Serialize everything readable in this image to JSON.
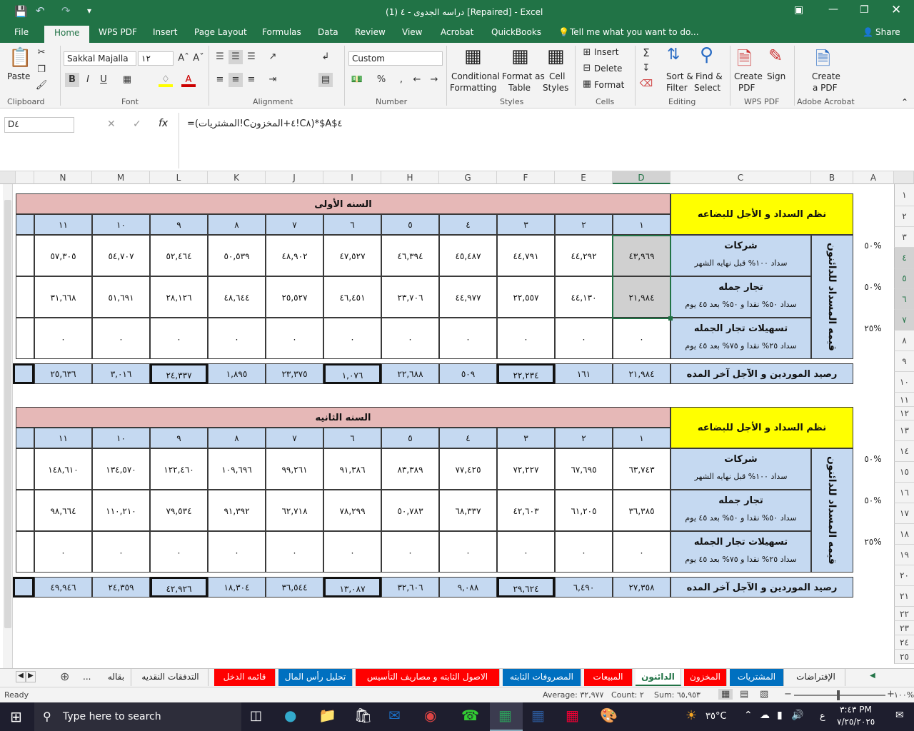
{
  "window": {
    "title": "دراسه الجدوى - ٤ (1) [Repaired] - Excel"
  },
  "tabs": [
    {
      "label": "File"
    },
    {
      "label": "Home"
    },
    {
      "label": "WPS PDF"
    },
    {
      "label": "Insert"
    },
    {
      "label": "Page Layout"
    },
    {
      "label": "Formulas"
    },
    {
      "label": "Data"
    },
    {
      "label": "Review"
    },
    {
      "label": "View"
    },
    {
      "label": "Acrobat"
    },
    {
      "label": "QuickBooks"
    }
  ],
  "tell_me": "Tell me what you want to do...",
  "share": "Share",
  "ribbon": {
    "clipboard": {
      "paste": "Paste",
      "label": "Clipboard"
    },
    "font": {
      "name": "Sakkal Majalla",
      "size": "١٢",
      "label": "Font"
    },
    "alignment": {
      "label": "Alignment"
    },
    "number": {
      "format": "Custom",
      "label": "Number",
      "percent": "%",
      "comma": ","
    },
    "styles": {
      "conditional": "Conditional",
      "formatting": "Formatting",
      "format_as": "Format as",
      "table": "Table",
      "cell": "Cell",
      "cell_styles": "Styles",
      "label": "Styles"
    },
    "cells": {
      "insert": "Insert",
      "delete": "Delete",
      "format": "Format",
      "label": "Cells"
    },
    "editing": {
      "sort": "Sort &",
      "filter": "Filter",
      "find": "Find &",
      "select": "Select",
      "label": "Editing"
    },
    "wps": {
      "create": "Create",
      "pdf": "PDF",
      "sign": "Sign",
      "label": "WPS PDF"
    },
    "acrobat": {
      "create": "Create",
      "apdf": "a PDF",
      "label": "Adobe Acrobat"
    }
  },
  "formula": {
    "namebox": "D٤",
    "text": "=(المشتريات!C٤+المخزون!C٨)*$A$٤"
  },
  "columns": [
    "N",
    "M",
    "L",
    "K",
    "J",
    "I",
    "H",
    "G",
    "F",
    "E",
    "D",
    "C",
    "B",
    "A"
  ],
  "rows": [
    "١",
    "٢",
    "٣",
    "٤",
    "٥",
    "٦",
    "٧",
    "٨",
    "٩",
    "١٠",
    "١١",
    "١٢",
    "١٣",
    "١٤",
    "١٥",
    "١٦",
    "١٧",
    "١٨",
    "١٩",
    "٢٠",
    "٢١",
    "٢٢",
    "٢٣",
    "٢٤",
    "٢٥"
  ],
  "sheet": {
    "header": "نظم السداد و الأجل للبضاعه",
    "side_label": "قيمه المسداد للدائنون",
    "rows_labels": [
      {
        "title": "شركات",
        "sub": "سداد ١٠٠% قبل نهايه الشهر"
      },
      {
        "title": "تجار جمله",
        "sub": "سداد ٥٠% نقدا و ٥٠% بعد ٤٥ يوم"
      },
      {
        "title": "تسهيلات تجار الجمله",
        "sub": "سداد ٢٥% نقدا و ٧٥% بعد ٤٥ يوم"
      }
    ],
    "total_label": "رصيد الموردين و الآجل آخر المده",
    "percents": [
      "٥٠%",
      "٥٠%",
      "٢٥%"
    ],
    "month_numbers": [
      "١",
      "٢",
      "٣",
      "٤",
      "٥",
      "٦",
      "٧",
      "٨",
      "٩",
      "١٠",
      "١١"
    ],
    "year1": {
      "title": "السنه الأولى",
      "row1": [
        "٤٣,٩٦٩",
        "٤٤,٢٩٢",
        "٤٤,٧٩١",
        "٤٥,٤٨٧",
        "٤٦,٣٩٤",
        "٤٧,٥٢٧",
        "٤٨,٩٠٢",
        "٥٠,٥٣٩",
        "٥٢,٤٦٤",
        "٥٤,٧٠٧",
        "٥٧,٣٠٥"
      ],
      "row2": [
        "٢١,٩٨٤",
        "٤٤,١٣٠",
        "٢٢,٥٥٧",
        "٤٤,٩٧٧",
        "٢٣,٧٠٦",
        "٤٦,٤٥١",
        "٢٥,٥٢٧",
        "٤٨,٦٤٤",
        "٢٨,١٢٦",
        "٥١,٦٩١",
        "٣١,٦٦٨"
      ],
      "row3": [
        "٠",
        "٠",
        "٠",
        "٠",
        "٠",
        "٠",
        "٠",
        "٠",
        "٠",
        "٠",
        "٠"
      ],
      "total": [
        "٢١,٩٨٤",
        "١٦١",
        "٢٢,٢٣٤",
        "٥٠٩",
        "٢٢,٦٨٨",
        "١,٠٧٦",
        "٢٣,٣٧٥",
        "١,٨٩٥",
        "٢٤,٣٣٧",
        "٣,٠١٦",
        "٢٥,٦٣٦"
      ]
    },
    "year2": {
      "title": "السنه الثانيه",
      "row1": [
        "٦٣,٧٤٣",
        "٦٧,٦٩٥",
        "٧٢,٢٢٧",
        "٧٧,٤٢٥",
        "٨٣,٣٨٩",
        "٩١,٣٨٦",
        "٩٩,٢٦١",
        "١٠٩,٦٩٦",
        "١٢٢,٤٦٠",
        "١٣٤,٥٧٠",
        "١٤٨,٦١٠"
      ],
      "row2": [
        "٣٦,٣٨٥",
        "٦١,٢٠٥",
        "٤٢,٦٠٣",
        "٦٨,٣٣٧",
        "٥٠,٧٨٣",
        "٧٨,٢٩٩",
        "٦٢,٧١٨",
        "٩١,٣٩٢",
        "٧٩,٥٣٤",
        "١١٠,٢١٠",
        "٩٨,٦٦٤"
      ],
      "row3": [
        "٠",
        "٠",
        "٠",
        "٠",
        "٠",
        "٠",
        "٠",
        "٠",
        "٠",
        "٠",
        "٠"
      ],
      "total": [
        "٢٧,٣٥٨",
        "٦,٤٩٠",
        "٢٩,٦٢٤",
        "٩,٠٨٨",
        "٣٢,٦٠٦",
        "١٣,٠٨٧",
        "٣٦,٥٤٤",
        "١٨,٣٠٤",
        "٤٢,٩٢٦",
        "٢٤,٣٥٩",
        "٤٩,٩٤٦"
      ]
    }
  },
  "sheet_tabs": [
    {
      "label": "بقاله",
      "color": "#f3f3f3",
      "text": "#222"
    },
    {
      "label": "التدفقات النقديه",
      "color": "#f3f3f3",
      "text": "#222"
    },
    {
      "label": "قائمه الدخل",
      "color": "#ff0000",
      "text": "#fff"
    },
    {
      "label": "تحليل رأس المال",
      "color": "#0070c0",
      "text": "#fff"
    },
    {
      "label": "الاصول الثابته و مصاريف التأسيس",
      "color": "#ff0000",
      "text": "#fff"
    },
    {
      "label": "المصروفات الثابته",
      "color": "#0070c0",
      "text": "#fff"
    },
    {
      "label": "المبيعات",
      "color": "#ff0000",
      "text": "#fff"
    },
    {
      "label": "الدائنون",
      "color": "#ffffff",
      "text": "#217346"
    },
    {
      "label": "المخزون",
      "color": "#ff0000",
      "text": "#fff"
    },
    {
      "label": "المشتريات",
      "color": "#0070c0",
      "text": "#fff"
    },
    {
      "label": "الإفتراضات",
      "color": "#f3f3f3",
      "text": "#222"
    }
  ],
  "status": {
    "ready": "Ready",
    "average": "Average: ٣٢,٩٧٧",
    "count": "Count: ٢",
    "sum": "Sum: ٦٥,٩٥٣",
    "zoom": "١٠٠%"
  },
  "taskbar": {
    "search": "Type here to search",
    "weather": "٣٥°C",
    "lang": "ع",
    "time": "٣:٤٣ PM",
    "date": "٧/٢٥/٢٠٢٥"
  }
}
